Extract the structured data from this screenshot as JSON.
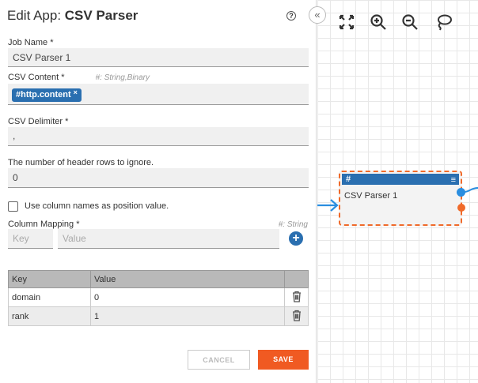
{
  "header": {
    "title_prefix": "Edit App: ",
    "title_app": "CSV Parser",
    "help_label": "?"
  },
  "form": {
    "job_name": {
      "label": "Job Name *",
      "value": "CSV Parser 1"
    },
    "csv_content": {
      "label": "CSV Content *",
      "hint": "#: String,Binary",
      "tag": "#http.content",
      "tag_remove": "×"
    },
    "csv_delimiter": {
      "label": "CSV Delimiter *",
      "value": ","
    },
    "header_rows": {
      "label": "The number of header rows to ignore.",
      "value": "0"
    },
    "use_column_names": {
      "label": "Use column names as position value.",
      "checked": false
    },
    "column_mapping": {
      "label": "Column Mapping *",
      "hint": "#: String",
      "key_placeholder": "Key",
      "value_placeholder": "Value",
      "add_label": "+"
    }
  },
  "mapping_table": {
    "columns": [
      "Key",
      "Value",
      ""
    ],
    "rows": [
      {
        "key": "domain",
        "value": "0"
      },
      {
        "key": "rank",
        "value": "1"
      }
    ]
  },
  "actions": {
    "cancel_label": "CANCEL",
    "save_label": "SAVE"
  },
  "canvas": {
    "collapse_label": "«",
    "tools": [
      "fit-screen-icon",
      "zoom-in-icon",
      "zoom-out-icon",
      "lasso-icon"
    ],
    "node": {
      "type_label": "#",
      "name": "CSV Parser 1",
      "menu_label": "≡"
    }
  },
  "colors": {
    "primary": "#2a6fb0",
    "accent": "#f05a22"
  }
}
